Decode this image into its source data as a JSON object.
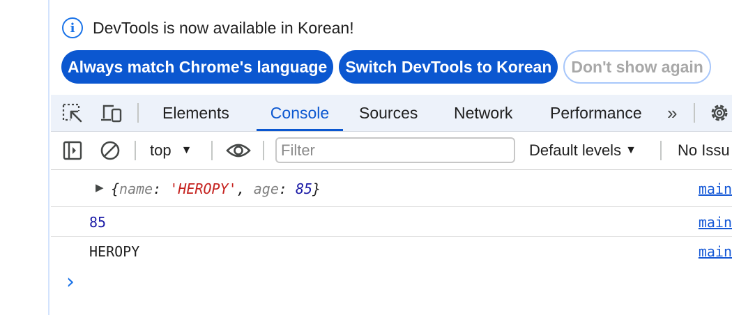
{
  "infobar": {
    "message": "DevTools is now available in Korean!",
    "info_glyph": "i",
    "buttons": {
      "always_match": "Always match Chrome's language",
      "switch": "Switch DevTools to Korean",
      "dont_show": "Don't show again"
    }
  },
  "tabs": {
    "elements": "Elements",
    "console": "Console",
    "sources": "Sources",
    "network": "Network",
    "performance": "Performance",
    "more": "»",
    "active": "Console"
  },
  "console_toolbar": {
    "context": "top",
    "filter_placeholder": "Filter",
    "levels": "Default levels",
    "issues": "No Issu"
  },
  "messages": {
    "obj": {
      "open": "{",
      "key1": "name",
      "colon1": ": ",
      "val1": "'HEROPY'",
      "comma": ", ",
      "key2": "age",
      "colon2": ": ",
      "val2": "85",
      "close": "}",
      "source": "main"
    },
    "num": {
      "text": "85",
      "source": "main"
    },
    "str": {
      "text": "HEROPY",
      "source": "main"
    },
    "prompt": "›"
  },
  "colors": {
    "accent": "#0b57d0",
    "tabbar_bg": "#edf2fa",
    "string_red": "#c5221f",
    "number_blue": "#1a1aa6",
    "key_gray": "#7f7f7f"
  }
}
